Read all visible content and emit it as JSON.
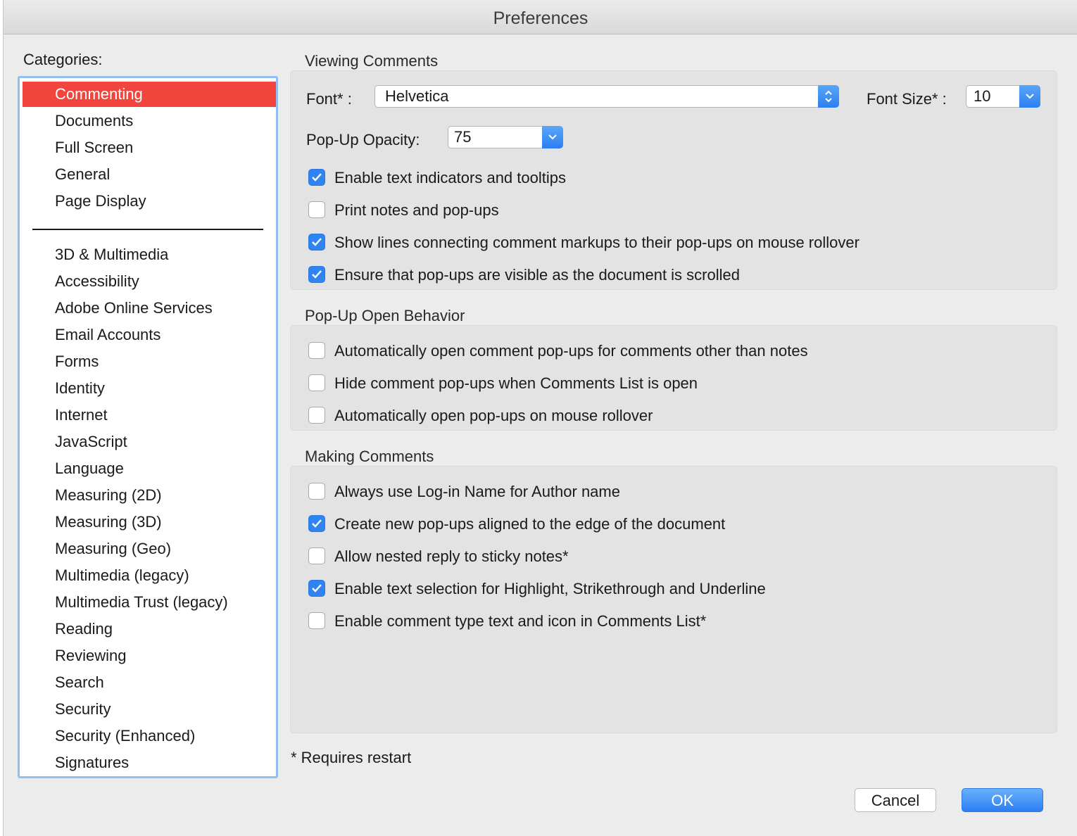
{
  "window": {
    "title": "Preferences"
  },
  "sidebar": {
    "label": "Categories:",
    "items": [
      {
        "label": "Commenting",
        "selected": true
      },
      {
        "label": "Documents"
      },
      {
        "label": "Full Screen"
      },
      {
        "label": "General"
      },
      {
        "label": "Page Display"
      },
      {
        "label": "3D & Multimedia"
      },
      {
        "label": "Accessibility"
      },
      {
        "label": "Adobe Online Services"
      },
      {
        "label": "Email Accounts"
      },
      {
        "label": "Forms"
      },
      {
        "label": "Identity"
      },
      {
        "label": "Internet"
      },
      {
        "label": "JavaScript"
      },
      {
        "label": "Language"
      },
      {
        "label": "Measuring (2D)"
      },
      {
        "label": "Measuring (3D)"
      },
      {
        "label": "Measuring (Geo)"
      },
      {
        "label": "Multimedia (legacy)"
      },
      {
        "label": "Multimedia Trust (legacy)"
      },
      {
        "label": "Reading"
      },
      {
        "label": "Reviewing"
      },
      {
        "label": "Search"
      },
      {
        "label": "Security"
      },
      {
        "label": "Security (Enhanced)"
      },
      {
        "label": "Signatures"
      }
    ]
  },
  "viewing": {
    "title": "Viewing Comments",
    "font_label": "Font* :",
    "font_value": "Helvetica",
    "font_size_label": "Font Size* :",
    "font_size_value": "10",
    "opacity_label": "Pop-Up Opacity:",
    "opacity_value": "75",
    "options": [
      {
        "label": "Enable text indicators and tooltips",
        "checked": true
      },
      {
        "label": "Print notes and pop-ups",
        "checked": false
      },
      {
        "label": "Show lines connecting comment markups to their pop-ups on mouse rollover",
        "checked": true
      },
      {
        "label": "Ensure that pop-ups are visible as the document is scrolled",
        "checked": true
      }
    ]
  },
  "popup": {
    "title": "Pop-Up Open Behavior",
    "options": [
      {
        "label": "Automatically open comment pop-ups for comments other than notes",
        "checked": false
      },
      {
        "label": "Hide comment pop-ups when Comments List is open",
        "checked": false
      },
      {
        "label": "Automatically open pop-ups on mouse rollover",
        "checked": false
      }
    ]
  },
  "making": {
    "title": "Making Comments",
    "options": [
      {
        "label": "Always use Log-in Name for Author name",
        "checked": false
      },
      {
        "label": "Create new pop-ups aligned to the edge of the document",
        "checked": true
      },
      {
        "label": "Allow nested reply to sticky notes*",
        "checked": false
      },
      {
        "label": "Enable text selection for Highlight, Strikethrough and Underline",
        "checked": true
      },
      {
        "label": "Enable comment type text and icon in Comments List*",
        "checked": false
      }
    ]
  },
  "footer": {
    "note": "* Requires restart",
    "cancel_label": "Cancel",
    "ok_label": "OK"
  },
  "colors": {
    "selection": "#f2453d",
    "accent": "#2f84f1",
    "list_focus_ring": "#90bff0"
  }
}
